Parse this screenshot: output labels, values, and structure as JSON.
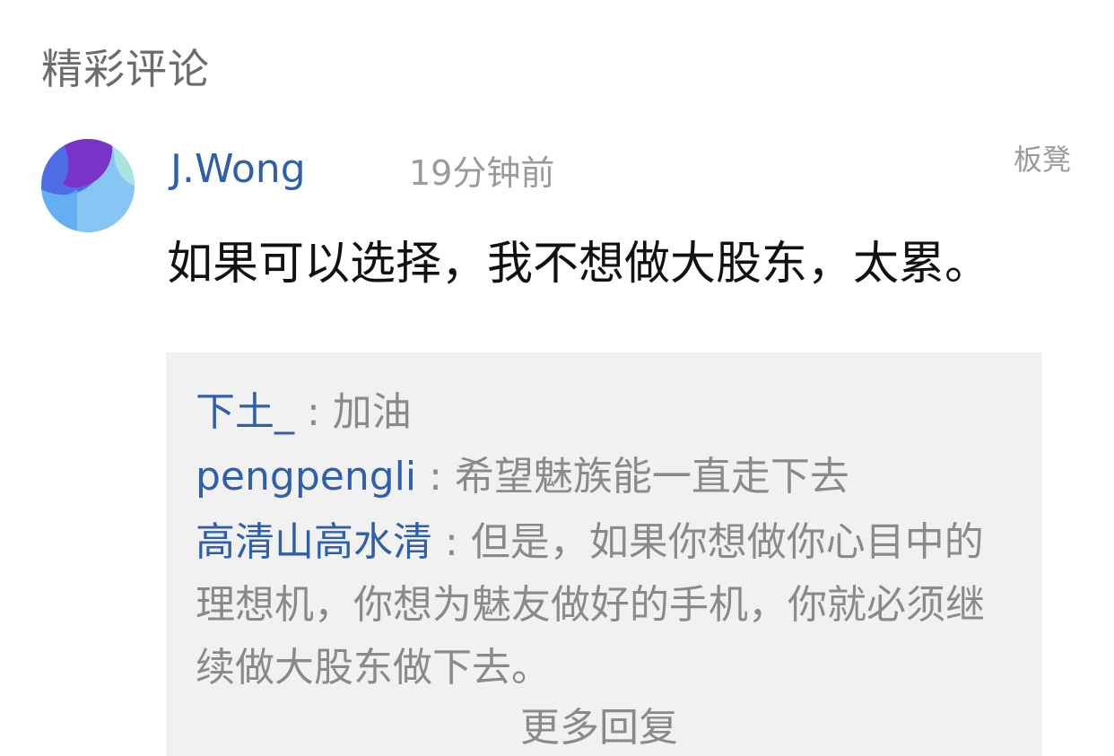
{
  "section": {
    "title": "精彩评论"
  },
  "comment": {
    "username": "J.Wong",
    "time": "19分钟前",
    "floor_label": "板凳",
    "text": "如果可以选择，我不想做大股东，太累。",
    "avatar_icon": "avatar-icon"
  },
  "replies": [
    {
      "author": "下土_",
      "separator": " : ",
      "text": "加油"
    },
    {
      "author": "pengpengli",
      "separator": " : ",
      "text": "希望魅族能一直走下去"
    },
    {
      "author": "高清山高水清",
      "separator": " : ",
      "text": "但是，如果你想做你心目中的理想机，你想为魅友做好的手机，你就必须继续做大股东做下去。"
    }
  ],
  "more_replies_label": "更多回复",
  "colors": {
    "link_blue": "#2f5fa8",
    "muted_gray": "#8a8a8a",
    "reply_box_bg": "#f1f1f1",
    "text_black": "#111111"
  }
}
